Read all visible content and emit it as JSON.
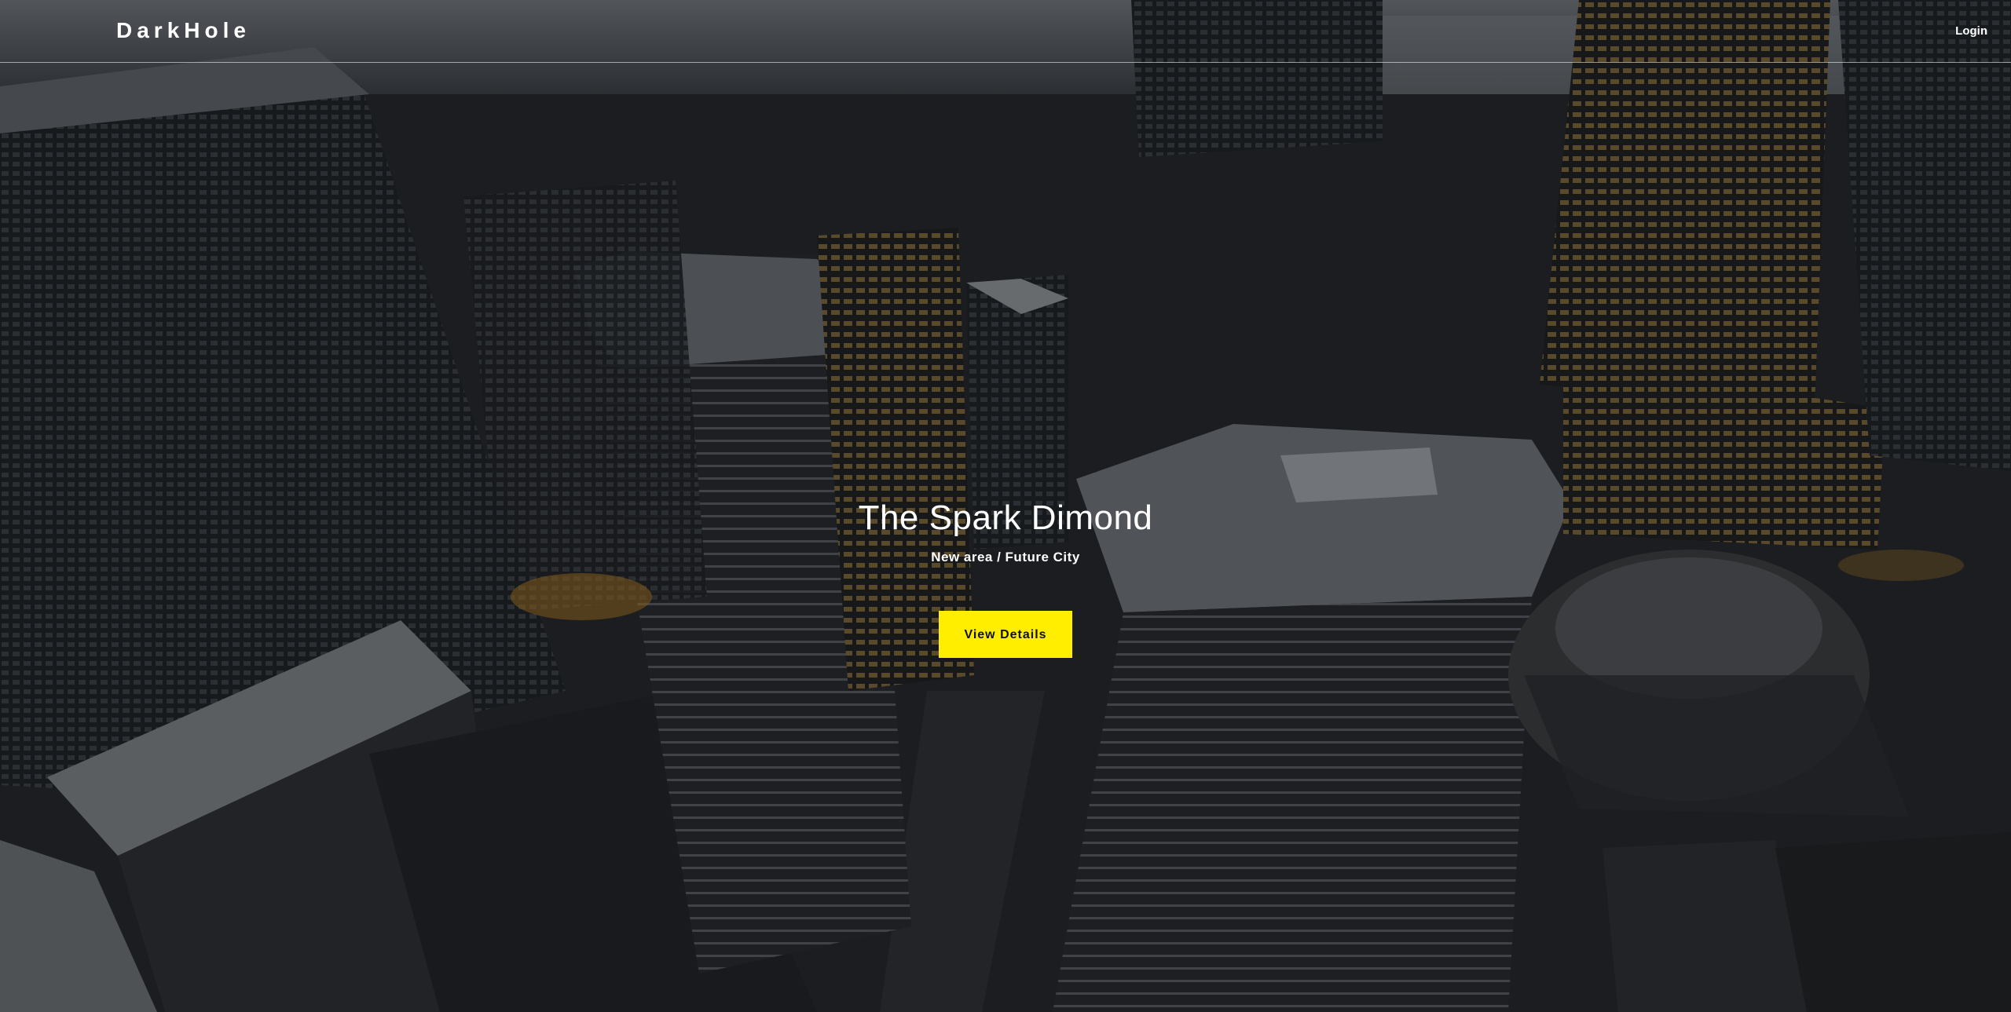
{
  "header": {
    "logo": "DarkHole",
    "login_label": "Login"
  },
  "hero": {
    "title": "The Spark Dimond",
    "subtitle": "New area / Future City",
    "cta_label": "View Details",
    "background_image": "aerial-city-skyline-at-dusk"
  },
  "colors": {
    "accent": "#ffee00",
    "text": "#ffffff",
    "header_border": "#ffffff"
  }
}
